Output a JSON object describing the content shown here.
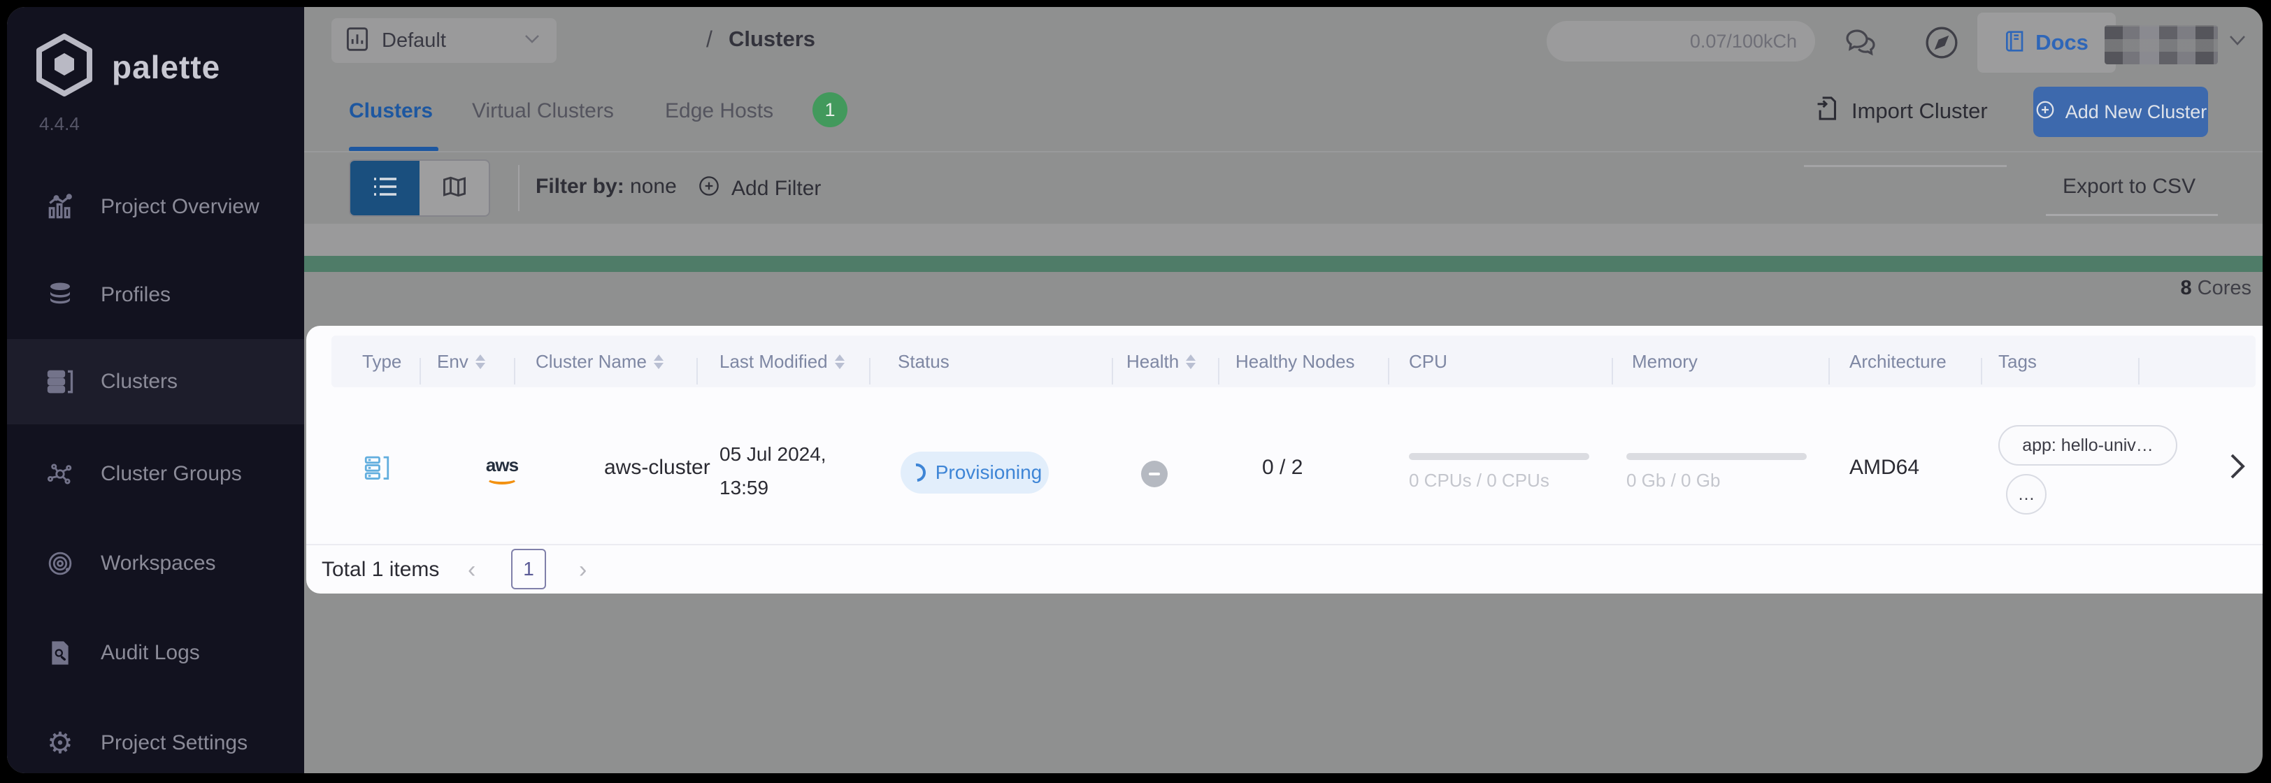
{
  "app": {
    "brand": "palette",
    "version": "4.4.4"
  },
  "colors": {
    "sidebar_bg": "#12121f",
    "sidebar_active_bg": "#1d1d2b",
    "content_dim_bg": "#8f9090",
    "accent_blue": "#1d57a0",
    "button_blue": "#3d69ad",
    "toggle_active_blue": "#1a4f7e",
    "green_bar": "#4f7c68",
    "badge_green": "#42995c",
    "status_pill_bg": "#e2eefb",
    "status_text": "#3e85d6",
    "card_bg": "#fcfcfe",
    "header_strip_bg": "#f4f5fa"
  },
  "sidebar": {
    "items": [
      {
        "label": "Project Overview",
        "icon": "project-overview-icon",
        "active": false
      },
      {
        "label": "Profiles",
        "icon": "profiles-icon",
        "active": false
      },
      {
        "label": "Clusters",
        "icon": "clusters-icon",
        "active": true
      },
      {
        "label": "Cluster Groups",
        "icon": "cluster-groups-icon",
        "active": false
      },
      {
        "label": "Workspaces",
        "icon": "workspaces-icon",
        "active": false
      },
      {
        "label": "Audit Logs",
        "icon": "audit-logs-icon",
        "active": false
      },
      {
        "label": "Project Settings",
        "icon": "project-settings-icon",
        "active": false
      }
    ]
  },
  "topbar": {
    "project_selector": {
      "value": "Default",
      "icon": "chart-icon",
      "chevron": "chevron-down-icon"
    },
    "breadcrumb": {
      "separator": "/",
      "current": "Clusters"
    },
    "usage_badge": "0.07/100kCh",
    "icons": [
      "chat-icon",
      "compass-icon"
    ],
    "docs": {
      "label": "Docs",
      "icon": "book-icon"
    },
    "user": {
      "redacted": true,
      "chevron": "chevron-down-icon"
    }
  },
  "tabs": {
    "items": [
      {
        "label": "Clusters",
        "active": true
      },
      {
        "label": "Virtual Clusters",
        "active": false
      },
      {
        "label": "Edge Hosts",
        "active": false,
        "badge": "1"
      }
    ]
  },
  "actions": {
    "import_label": "Import Cluster",
    "add_label": "Add New Cluster"
  },
  "filter_bar": {
    "view_modes": [
      "list",
      "map"
    ],
    "filter_by_label": "Filter by:",
    "filter_by_value": "none",
    "add_filter_label": "Add Filter",
    "export_label": "Export to CSV"
  },
  "usage_strip": {
    "cores_count": "8",
    "cores_label": " Cores"
  },
  "table": {
    "columns": [
      {
        "label": "Type",
        "sortable": false
      },
      {
        "label": "Env",
        "sortable": true
      },
      {
        "label": "Cluster Name",
        "sortable": true
      },
      {
        "label": "Last Modified",
        "sortable": true
      },
      {
        "label": "Status",
        "sortable": false
      },
      {
        "label": "Health",
        "sortable": true
      },
      {
        "label": "Healthy Nodes",
        "sortable": false
      },
      {
        "label": "CPU",
        "sortable": false
      },
      {
        "label": "Memory",
        "sortable": false
      },
      {
        "label": "Architecture",
        "sortable": false
      },
      {
        "label": "Tags",
        "sortable": false
      }
    ],
    "rows": [
      {
        "type_icon": "cluster-type-icon",
        "env": "aws",
        "name": "aws-cluster",
        "modified_line1": "05 Jul 2024,",
        "modified_line2": "13:59",
        "status": "Provisioning",
        "health": "unknown",
        "healthy_nodes": "0 / 2",
        "cpu": "0 CPUs / 0 CPUs",
        "memory": "0 Gb / 0 Gb",
        "architecture": "AMD64",
        "tags": [
          "app: hello-univ…",
          "…"
        ]
      }
    ]
  },
  "pagination": {
    "total": "Total 1 items",
    "page": "1"
  }
}
